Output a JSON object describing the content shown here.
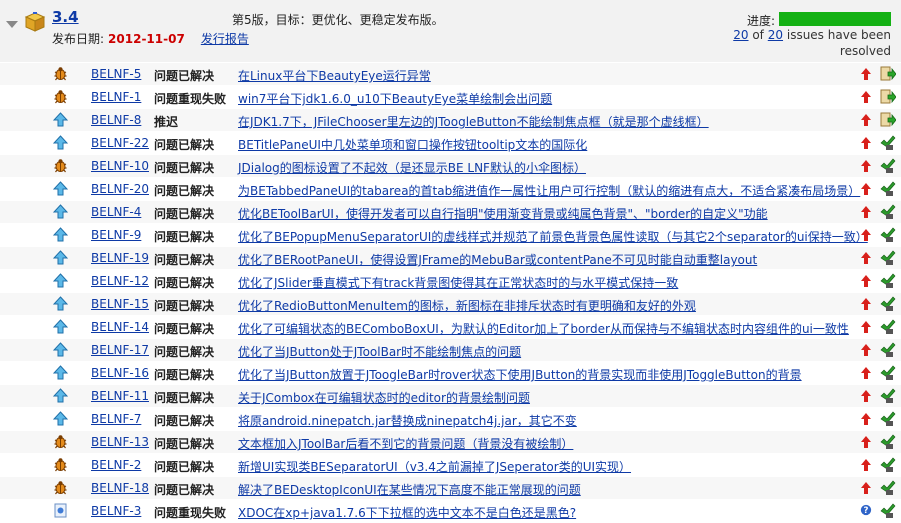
{
  "version": {
    "name": "3.4",
    "release_date_label": "发布日期:",
    "release_date": "2012-11-07",
    "report_link": "发行报告",
    "description": "第5版，目标：更优化、更稳定发布版。"
  },
  "progress": {
    "label": "进度:",
    "fraction": 1.0,
    "resolved": "20",
    "of_text": "of",
    "total": "20",
    "suffix": "issues have been resolved",
    "color": "#14b114"
  },
  "colors": {
    "link": "#0e3aa6",
    "date": "#cc0000",
    "priority": "#cc0000"
  },
  "issues": [
    {
      "type": "bug",
      "key": "BELNF-5",
      "resolution": "问题已解决",
      "summary": "在Linux平台下BeautyEye运行异常",
      "priority": "up-arrow-icon",
      "status": "reopened"
    },
    {
      "type": "bug",
      "key": "BELNF-1",
      "resolution": "问题重现失败",
      "summary": "win7平台下jdk1.6.0_u10下BeautyEye菜单绘制会出问题",
      "priority": "up-arrow-icon",
      "status": "reopened"
    },
    {
      "type": "improvement",
      "key": "BELNF-8",
      "resolution": "推迟",
      "summary": "在JDK1.7下，JFileChooser里左边的JToogleButton不能绘制焦点框（就是那个虚线框）",
      "priority": "up-arrow-icon",
      "status": "reopened"
    },
    {
      "type": "improvement",
      "key": "BELNF-22",
      "resolution": "问题已解决",
      "summary": "BETitlePaneUI中几处菜单项和窗口操作按钮tooltip文本的国际化",
      "priority": "up-arrow-icon",
      "status": "resolved"
    },
    {
      "type": "bug",
      "key": "BELNF-10",
      "resolution": "问题已解决",
      "summary": "JDialog的图标设置了不起效（是还显示BE LNF默认的小伞图标）",
      "priority": "up-arrow-icon",
      "status": "resolved"
    },
    {
      "type": "improvement",
      "key": "BELNF-20",
      "resolution": "问题已解决",
      "summary": "为BETabbedPaneUI的tabarea的首tab缩进值作一属性让用户可行控制（默认的缩进有点大，不适合紧凑布局场景）",
      "priority": "up-arrow-icon",
      "status": "resolved"
    },
    {
      "type": "improvement",
      "key": "BELNF-4",
      "resolution": "问题已解决",
      "summary": "优化BEToolBarUI，使得开发者可以自行指明\"使用渐变背景或纯属色背景\"、\"border的自定义\"功能",
      "priority": "up-arrow-icon",
      "status": "resolved"
    },
    {
      "type": "improvement",
      "key": "BELNF-9",
      "resolution": "问题已解决",
      "summary": "优化了BEPopupMenuSeparatorUI的虚线样式并规范了前景色背景色属性读取（与其它2个separator的ui保持一致）",
      "priority": "up-arrow-icon",
      "status": "resolved"
    },
    {
      "type": "improvement",
      "key": "BELNF-19",
      "resolution": "问题已解决",
      "summary": "优化了BERootPaneUI，使得设置JFrame的MebuBar或contentPane不可见时能自动重整layout",
      "priority": "up-arrow-icon",
      "status": "resolved"
    },
    {
      "type": "improvement",
      "key": "BELNF-12",
      "resolution": "问题已解决",
      "summary": "优化了JSlider垂直模式下有track背景图使得其在正常状态时的与水平模式保持一致",
      "priority": "up-arrow-icon",
      "status": "resolved"
    },
    {
      "type": "improvement",
      "key": "BELNF-15",
      "resolution": "问题已解决",
      "summary": "优化了RedioButtonMenuItem的图标，新图标在非排斥状态时有更明确和友好的外观",
      "priority": "up-arrow-icon",
      "status": "resolved"
    },
    {
      "type": "improvement",
      "key": "BELNF-14",
      "resolution": "问题已解决",
      "summary": "优化了可编辑状态的BEComboBoxUI，为默认的Editor加上了border从而保持与不编辑状态时内容组件的ui一致性",
      "priority": "up-arrow-icon",
      "status": "resolved"
    },
    {
      "type": "improvement",
      "key": "BELNF-17",
      "resolution": "问题已解决",
      "summary": "优化了当JButton处于JToolBar时不能绘制焦点的问题",
      "priority": "up-arrow-icon",
      "status": "resolved"
    },
    {
      "type": "improvement",
      "key": "BELNF-16",
      "resolution": "问题已解决",
      "summary": "优化了当JButton放置于JToogleBar时rover状态下使用JButton的背景实现而非使用JToggleButton的背景",
      "priority": "up-arrow-icon",
      "status": "resolved"
    },
    {
      "type": "improvement",
      "key": "BELNF-11",
      "resolution": "问题已解决",
      "summary": "关于JCombox在可编辑状态时的editor的背景绘制问题",
      "priority": "up-arrow-icon",
      "status": "resolved"
    },
    {
      "type": "improvement",
      "key": "BELNF-7",
      "resolution": "问题已解决",
      "summary": "将原android.ninepatch.jar替换成ninepatch4j.jar，其它不变",
      "priority": "up-arrow-icon",
      "status": "resolved"
    },
    {
      "type": "bug",
      "key": "BELNF-13",
      "resolution": "问题已解决",
      "summary": "文本框加入JToolBar后看不到它的背景问题（背景没有被绘制）",
      "priority": "up-arrow-icon",
      "status": "resolved"
    },
    {
      "type": "bug",
      "key": "BELNF-2",
      "resolution": "问题已解决",
      "summary": "新增UI实现类BESeparatorUI（v3.4之前漏掉了JSeperator类的UI实现）",
      "priority": "up-arrow-icon",
      "status": "resolved"
    },
    {
      "type": "bug",
      "key": "BELNF-18",
      "resolution": "问题已解决",
      "summary": "解决了BEDesktopIconUI在某些情况下高度不能正常展现的问题",
      "priority": "up-arrow-icon",
      "status": "resolved"
    },
    {
      "type": "question",
      "key": "BELNF-3",
      "resolution": "问题重现失败",
      "summary": "XDOC在xp+java1.7.6下下拉框的选中文本不是白色还是黑色?",
      "priority": "help-icon",
      "status": "resolved"
    }
  ]
}
